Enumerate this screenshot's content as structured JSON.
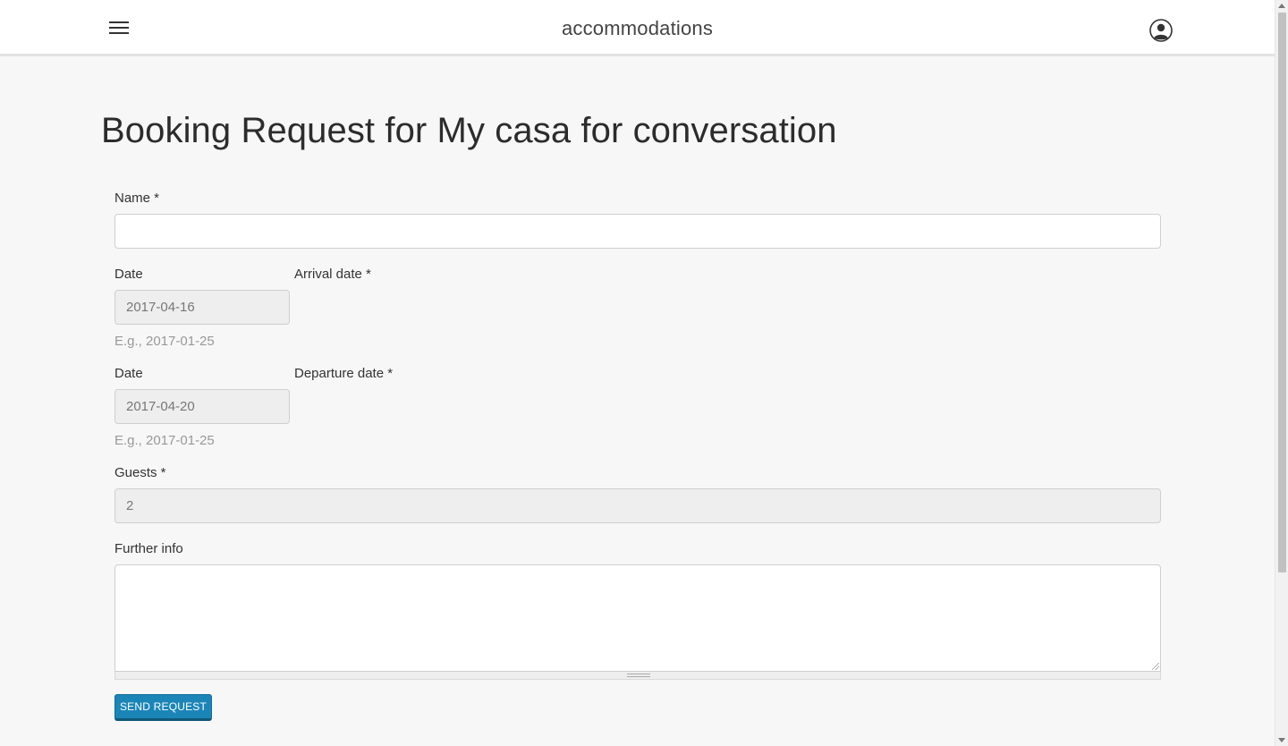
{
  "header": {
    "brand": "accommodations",
    "menu_icon": "hamburger-menu-icon",
    "user_icon": "user-account-icon"
  },
  "page": {
    "title": "Booking Request for My casa for conversation"
  },
  "form": {
    "name": {
      "label": "Name *",
      "value": ""
    },
    "arrival": {
      "date_label": "Date",
      "label": "Arrival date *",
      "value": "2017-04-16",
      "hint": "E.g., 2017-01-25"
    },
    "departure": {
      "date_label": "Date",
      "label": "Departure date *",
      "value": "2017-04-20",
      "hint": "E.g., 2017-01-25"
    },
    "guests": {
      "label": "Guests *",
      "value": "2"
    },
    "further_info": {
      "label": "Further info",
      "value": ""
    },
    "submit_label": "SEND REQUEST"
  },
  "colors": {
    "accent": "#1b85b8",
    "background": "#f7f7f7",
    "disabled_field": "#eeeeee"
  }
}
